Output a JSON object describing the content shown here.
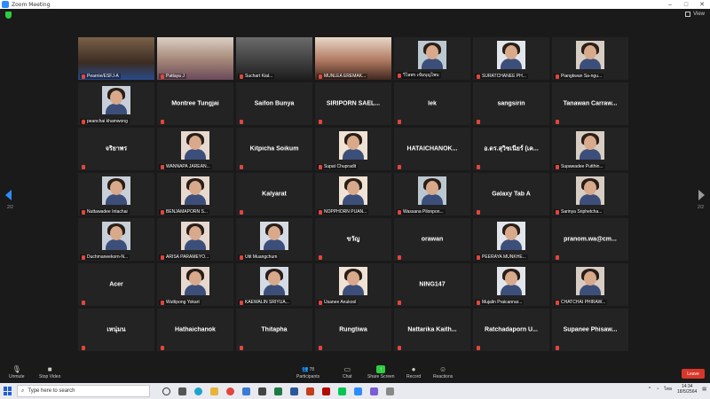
{
  "window": {
    "title": "Zoom Meeting",
    "view_label": "View"
  },
  "pager": {
    "left": "2/2",
    "right": "2/2"
  },
  "participants": [
    {
      "name": "Pearnie/ESFJ-A",
      "style": "cam"
    },
    {
      "name": "Pattaya J",
      "style": "cam"
    },
    {
      "name": "Suchart Kiat...",
      "style": "cam"
    },
    {
      "name": "MUNLEA EREMAK...",
      "style": "cam"
    },
    {
      "name": "วิไลพร เข้มบุญไพบ",
      "style": "pic"
    },
    {
      "name": "SURATCHANEE PH...",
      "style": "pic"
    },
    {
      "name": "Piangkwan Sa-ngu...",
      "style": "pic"
    },
    {
      "name": "peanchai khamwong",
      "style": "pic"
    },
    {
      "name": "Montree Tungjai",
      "style": "text"
    },
    {
      "name": "Saifon Bunya",
      "style": "text"
    },
    {
      "name": "SIRIPORN  SAEL...",
      "style": "text"
    },
    {
      "name": "lek",
      "style": "text"
    },
    {
      "name": "sangsirin",
      "style": "text"
    },
    {
      "name": "Tanawan  Carraw...",
      "style": "text"
    },
    {
      "name": "จริยาพร",
      "style": "text"
    },
    {
      "name": "WANNAPA JAREAN...",
      "style": "pic"
    },
    {
      "name": "Kitpicha Soikum",
      "style": "text"
    },
    {
      "name": "Supat Chupradit",
      "style": "pic"
    },
    {
      "name": "HATAICHANOK...",
      "style": "text"
    },
    {
      "name": "อ.ดร.สุวิชเนียร์ (เค...",
      "style": "text"
    },
    {
      "name": "Supawadee Putthin...",
      "style": "pic"
    },
    {
      "name": "Nuttawadee Intachai",
      "style": "pic"
    },
    {
      "name": "BENJAMAPORN S...",
      "style": "pic"
    },
    {
      "name": "Kalyarat",
      "style": "text"
    },
    {
      "name": "NOPPHORN PUAN...",
      "style": "pic"
    },
    {
      "name": "Wassana Pilonpon...",
      "style": "pic"
    },
    {
      "name": "Galaxy Tab A",
      "style": "text"
    },
    {
      "name": "Sarinya Sriphetcha...",
      "style": "pic"
    },
    {
      "name": "Duchmaneekorn-N...",
      "style": "pic"
    },
    {
      "name": "ARISA PARAMEYO...",
      "style": "pic"
    },
    {
      "name": "Utit Muangchum",
      "style": "pic"
    },
    {
      "name": "ขวัญ",
      "style": "text"
    },
    {
      "name": "orawan",
      "style": "text"
    },
    {
      "name": "PEERAYA MUNKHE...",
      "style": "pic"
    },
    {
      "name": "pranom.wa@cm...",
      "style": "text"
    },
    {
      "name": "Acer",
      "style": "text"
    },
    {
      "name": "Wuttipong Yokart",
      "style": "pic"
    },
    {
      "name": "KAEWALIN SRIYUA...",
      "style": "pic"
    },
    {
      "name": "Usanee Anukool",
      "style": "pic"
    },
    {
      "name": "NING147",
      "style": "text"
    },
    {
      "name": "Mujalin Praicannar...",
      "style": "pic"
    },
    {
      "name": "CHATCHAI PHIRAW...",
      "style": "pic"
    },
    {
      "name": "เหนุ่มน",
      "style": "text"
    },
    {
      "name": "Hathaichanok",
      "style": "text"
    },
    {
      "name": "Thitapha",
      "style": "text"
    },
    {
      "name": "Rungtiwa",
      "style": "text"
    },
    {
      "name": "Nattarika  Kaith...",
      "style": "text"
    },
    {
      "name": "Ratchadaporn  U...",
      "style": "text"
    },
    {
      "name": "Supanee  Phisaw...",
      "style": "text"
    }
  ],
  "toolbar": {
    "unmute": "Unmute",
    "stop_video": "Stop Video",
    "participants": "Participants",
    "participants_count": "78",
    "chat": "Chat",
    "share_screen": "Share Screen",
    "record": "Record",
    "reactions": "Reactions",
    "leave": "Leave"
  },
  "taskbar": {
    "search_placeholder": "Type here to search",
    "time": "14:34",
    "date": "18/5/2564",
    "lang": "ไทย"
  },
  "colors": {
    "accent": "#2d8cff",
    "leave": "#d9362b",
    "share": "#2ecc40",
    "mic_off": "#e0463c"
  }
}
